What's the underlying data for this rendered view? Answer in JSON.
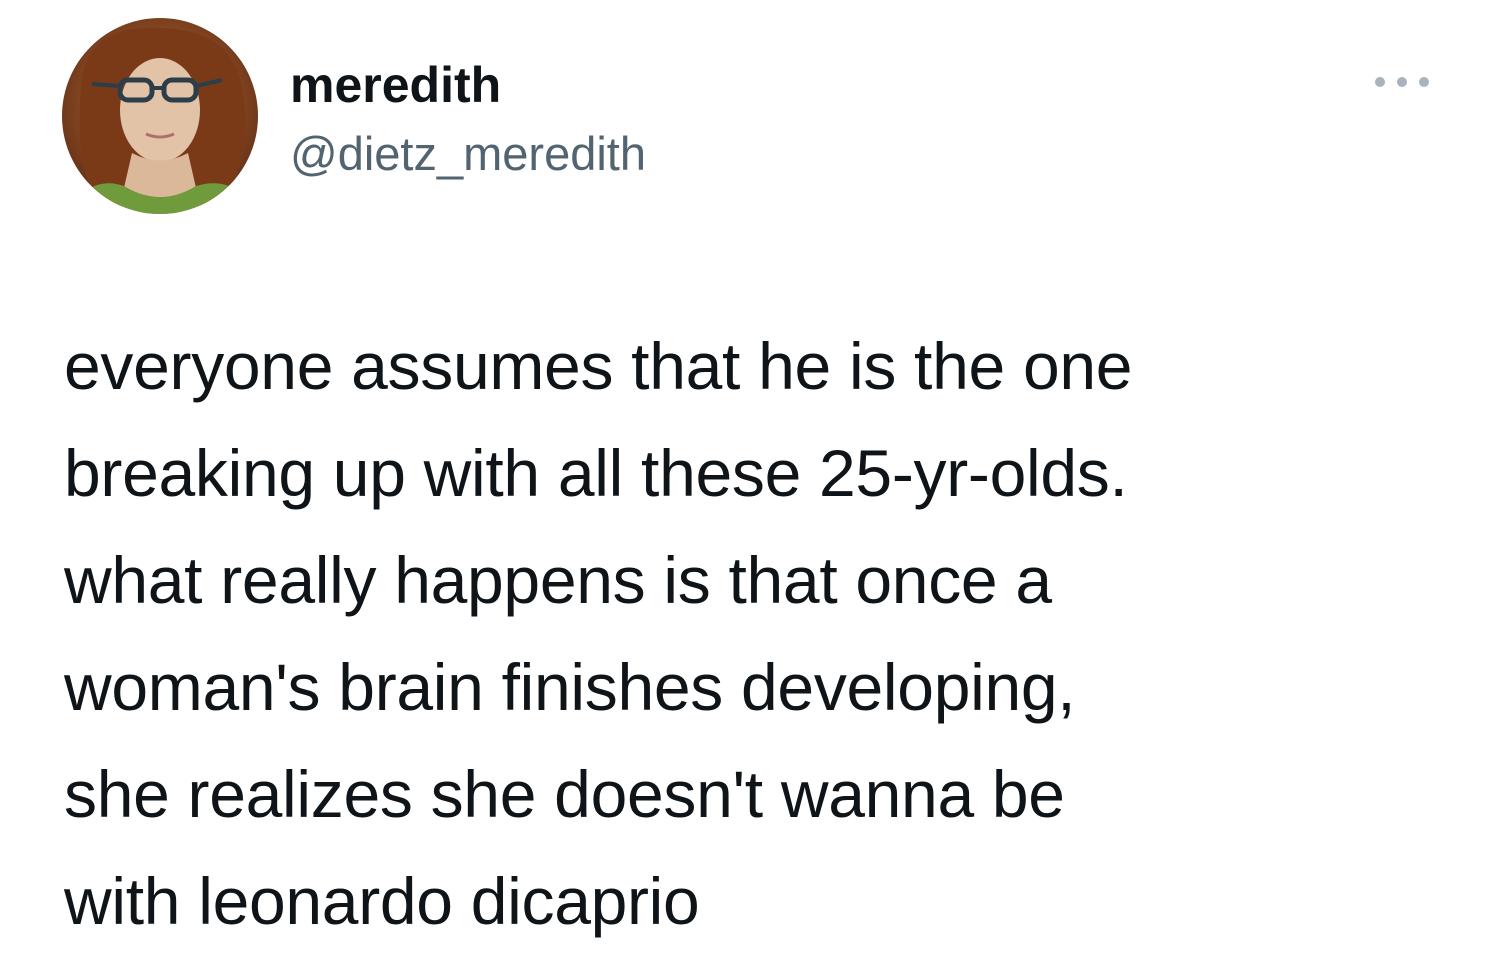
{
  "tweet": {
    "author": {
      "display_name": "meredith",
      "handle": "@dietz_meredith",
      "avatar_icon": "profile-photo"
    },
    "more_icon": "more-options-icon",
    "text_lines": [
      "everyone assumes that he is the one",
      "breaking up with all these 25-yr-olds.",
      "what really happens is that once a",
      "woman's brain finishes developing,",
      "she realizes she doesn't wanna be",
      "with leonardo dicaprio"
    ]
  },
  "colors": {
    "text_primary": "#0f1419",
    "text_secondary": "#536471",
    "icon_gray": "#a8b3bd",
    "background": "#ffffff"
  }
}
